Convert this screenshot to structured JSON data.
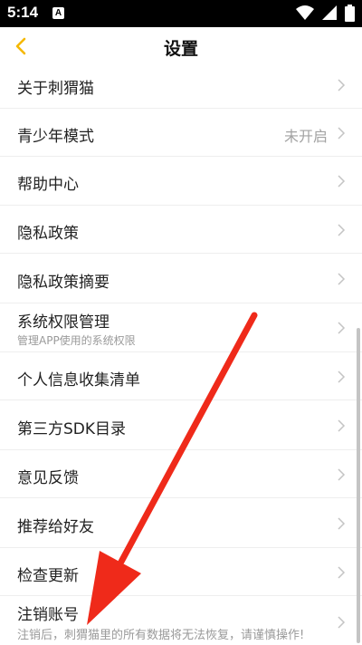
{
  "status_bar": {
    "time": "5:14",
    "notification_badge": "A",
    "icons": [
      "wifi-icon",
      "signal-icon",
      "battery-icon"
    ]
  },
  "nav": {
    "title": "设置",
    "back_icon": "chevron-left-icon"
  },
  "colors": {
    "accent": "#f5b800",
    "annotation_arrow": "#ef2a1a"
  },
  "settings": [
    {
      "label": "关于刺猬猫"
    },
    {
      "label": "青少年模式",
      "value": "未开启"
    },
    {
      "label": "帮助中心"
    },
    {
      "label": "隐私政策"
    },
    {
      "label": "隐私政策摘要"
    },
    {
      "label": "系统权限管理",
      "subtitle": "管理APP使用的系统权限"
    },
    {
      "label": "个人信息收集清单"
    },
    {
      "label": "第三方SDK目录"
    },
    {
      "label": "意见反馈"
    },
    {
      "label": "推荐给好友"
    },
    {
      "label": "检查更新"
    },
    {
      "label": "注销账号",
      "subtitle": "注销后，刺猬猫里的所有数据将无法恢复，请谨慎操作!"
    }
  ]
}
